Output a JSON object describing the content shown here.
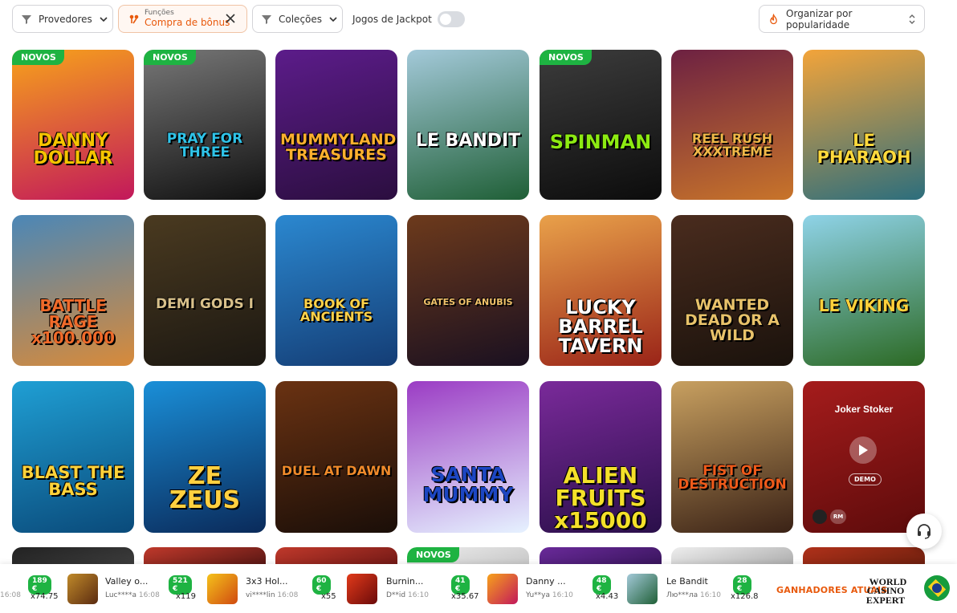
{
  "filters": {
    "providers_label": "Provedores",
    "functions_small": "Funções",
    "functions_value": "Compra de bônus",
    "collections_label": "Coleções",
    "jackpot_label": "Jogos de Jackpot",
    "sort_label": "Organizar por popularidade"
  },
  "games": [
    {
      "title": "DANNY DOLLAR",
      "badge": "NOVOS",
      "colors": [
        "#f7a21b",
        "#c2185b"
      ],
      "text": "#f5c400"
    },
    {
      "title": "PRAY FOR THREE",
      "badge": "NOVOS",
      "colors": [
        "#777",
        "#111"
      ],
      "text": "#2fc3e8"
    },
    {
      "title": "MUMMYLAND TREASURES",
      "badge": "",
      "colors": [
        "#5c1c8a",
        "#2b0e3f"
      ],
      "text": "#ffb02e"
    },
    {
      "title": "LE BANDIT",
      "badge": "",
      "colors": [
        "#a3c9d9",
        "#1f5f36"
      ],
      "text": "#ffffff"
    },
    {
      "title": "SPINMAN",
      "badge": "NOVOS",
      "colors": [
        "#3c3c3c",
        "#0c0c0c"
      ],
      "text": "#8dea12"
    },
    {
      "title": "REEL RUSH XXXTREME",
      "badge": "",
      "colors": [
        "#6d2142",
        "#c8742a"
      ],
      "text": "#f0b848"
    },
    {
      "title": "LE PHARAOH",
      "badge": "",
      "colors": [
        "#f3a43a",
        "#2c6e7d"
      ],
      "text": "#ffd93c"
    },
    {
      "title": "BATTLE RAGE x100.000",
      "badge": "",
      "colors": [
        "#4b87b7",
        "#d88a3a"
      ],
      "text": "#ef6a2a"
    },
    {
      "title": "DEMI GODS I",
      "badge": "",
      "colors": [
        "#4a3a20",
        "#1c1812"
      ],
      "text": "#d8c08a"
    },
    {
      "title": "BOOK OF ANCIENTS",
      "badge": "",
      "colors": [
        "#2b88d0",
        "#143d75"
      ],
      "text": "#ffd24a"
    },
    {
      "title": "GATES OF ANUBIS",
      "badge": "",
      "colors": [
        "#6d3a1c",
        "#1a1020"
      ],
      "text": "#f1c36a"
    },
    {
      "title": "LUCKY BARREL TAVERN",
      "badge": "",
      "colors": [
        "#e9a14a",
        "#9a2418"
      ],
      "text": "#ffffff"
    },
    {
      "title": "WANTED DEAD OR A WILD",
      "badge": "",
      "colors": [
        "#4a2c1e",
        "#1a120c"
      ],
      "text": "#e8c26a"
    },
    {
      "title": "LE VIKING",
      "badge": "",
      "colors": [
        "#8fd3e8",
        "#2c6a24"
      ],
      "text": "#ffd03a"
    },
    {
      "title": "BLAST THE BASS",
      "badge": "",
      "colors": [
        "#1f9fd4",
        "#0a4a7a"
      ],
      "text": "#ffd23a"
    },
    {
      "title": "ZE ZEUS",
      "badge": "",
      "colors": [
        "#1a8fd8",
        "#0a2a5a"
      ],
      "text": "#ffd040"
    },
    {
      "title": "DUEL AT DAWN",
      "badge": "",
      "colors": [
        "#6a3212",
        "#1a0e08"
      ],
      "text": "#ef8a2a"
    },
    {
      "title": "SANTA MUMMY",
      "badge": "",
      "colors": [
        "#9b3cc4",
        "#e6f2ff"
      ],
      "text": "#1c46c2"
    },
    {
      "title": "ALIEN FRUITS x15000",
      "badge": "",
      "colors": [
        "#7a2a9a",
        "#2a0f4a"
      ],
      "text": "#f4e02a"
    },
    {
      "title": "FIST OF DESTRUCTION",
      "badge": "",
      "colors": [
        "#c8a060",
        "#3a2216"
      ],
      "text": "#ef5a1a"
    }
  ],
  "joker": {
    "title": "Joker Stoker",
    "demo": "DEMO",
    "provider_badge": "RM"
  },
  "next_row_badge": "NOVOS",
  "winners": [
    {
      "user": "",
      "amount": "189 €",
      "mult": "x74.75",
      "time": "16:08",
      "game": ""
    },
    {
      "game": "Valley o...",
      "user": "Luc****a",
      "time": "16:08",
      "amount": "521 €",
      "mult": "x119"
    },
    {
      "game": "3x3 Hol...",
      "user": "vi****lin",
      "time": "16:08",
      "amount": "60 €",
      "mult": "x55"
    },
    {
      "game": "Burnin...",
      "user": "D**id",
      "time": "16:10",
      "amount": "41 €",
      "mult": "x35.67"
    },
    {
      "game": "Danny ...",
      "user": "Yu**ya",
      "time": "16:10",
      "amount": "48 €",
      "mult": "x4.43"
    },
    {
      "game": "Le Bandit",
      "user": "Лю***ла",
      "time": "16:10",
      "amount": "28 €",
      "mult": "x126.8"
    }
  ],
  "winners_label": "GANHADORES ATUAIS",
  "brand": {
    "line1": "WORLD",
    "line2": "CASINO EXPERT"
  }
}
